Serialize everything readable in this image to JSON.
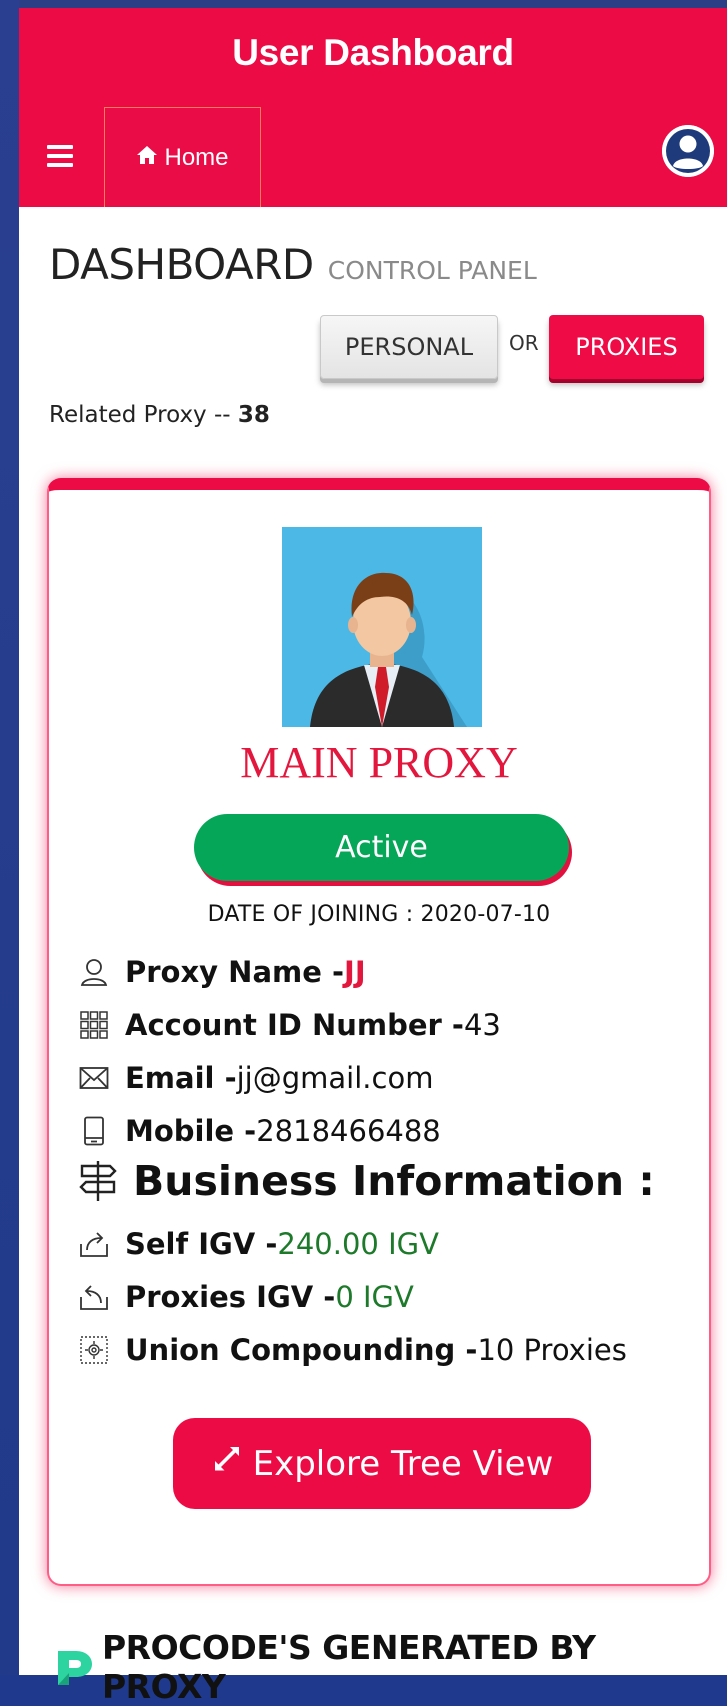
{
  "header": {
    "title": "User Dashboard",
    "menu_icon": "hamburger-icon",
    "home_icon": "home-icon",
    "home_label": "Home",
    "avatar_icon": "user-avatar-icon"
  },
  "page": {
    "title": "DASHBOARD",
    "subtitle": "CONTROL PANEL",
    "personal_label": "PERSONAL",
    "or_label": "OR",
    "proxies_label": "PROXIES",
    "related_label": "Related Proxy -- ",
    "related_count": "38"
  },
  "card": {
    "title": "MAIN PROXY",
    "status": "Active",
    "joining": "DATE OF JOINING : 2020-07-10",
    "proxy_name_label": "Proxy Name - ",
    "proxy_name": "JJ",
    "account_label": "Account ID Number - ",
    "account_id": "43",
    "email_label": "Email - ",
    "email": "jj@gmail.com",
    "mobile_label": "Mobile - ",
    "mobile": "2818466488",
    "business_heading": "Business Information :",
    "self_igv_label": "Self IGV - ",
    "self_igv": "240.00 IGV",
    "proxies_igv_label": "Proxies IGV - ",
    "proxies_igv": "0 IGV",
    "union_label": "Union Compounding - ",
    "union_value": "10 Proxies",
    "explore_label": "Explore Tree View"
  },
  "footer": {
    "text": "PROCODE'S GENERATED BY PROXY"
  },
  "colors": {
    "brand": "#ec0b45",
    "active": "#05a657",
    "value_green": "#1d7a2a",
    "background_blue": "#243f94"
  }
}
